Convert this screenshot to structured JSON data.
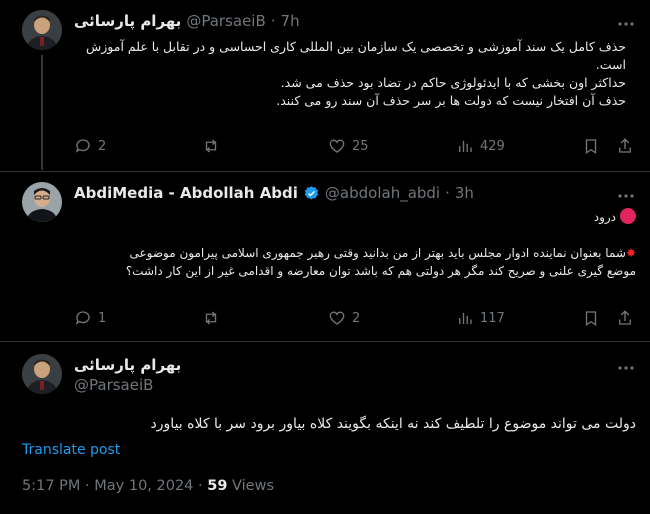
{
  "tweets": [
    {
      "display_name": "بهرام پارسائی",
      "handle": "@ParsaeiB",
      "time": "7h",
      "lines": [
        "حذف کامل یک سند آموزشی و تخصصی یک سازمان بین المللی کاری احساسی و در تقابل با علم آموزش",
        "است.",
        "حداکثر اون بخشی که با ایدئولوژی حاکم در تضاد بود حذف می شد.",
        "حذف آن افتخار نیست که دولت ها بر سر حذف آن سند رو می کنند."
      ],
      "replies": "2",
      "likes": "25",
      "views": "429"
    },
    {
      "display_name": "AbdiMedia - Abdollah Abdi",
      "handle": "@abdolah_abdi",
      "time": "3h",
      "first_line": "درود",
      "lines": [
        "شما بعنوان نماینده ادوار مجلس باید بهتر از من بدانید وقتی رهبر جمهوری اسلامی پیرامون موضوعی",
        "موضع گیری علنی و صریح کند مگر هر دولتی هم که باشد توان معارضه و اقدامی غیر از این کار داشت؟"
      ],
      "replies": "1",
      "likes": "2",
      "views": "117"
    }
  ],
  "focused": {
    "display_name": "بهرام پارسائی",
    "handle": "@ParsaeiB",
    "text": "دولت می تواند موضوع را تلطیف کند نه اینکه بگویند کلاه بیاور برود سر با کلاه بیاورد",
    "translate": "Translate post",
    "timestamp": "5:17 PM · May 10, 2024 · ",
    "views_count": "59",
    "views_label": " Views"
  },
  "colors": {
    "background": "#000000",
    "text": "#e7e9ea",
    "muted": "#71767b",
    "link": "#1d9bf0",
    "verified": "#1d9bf0",
    "divider": "#2f3336"
  }
}
